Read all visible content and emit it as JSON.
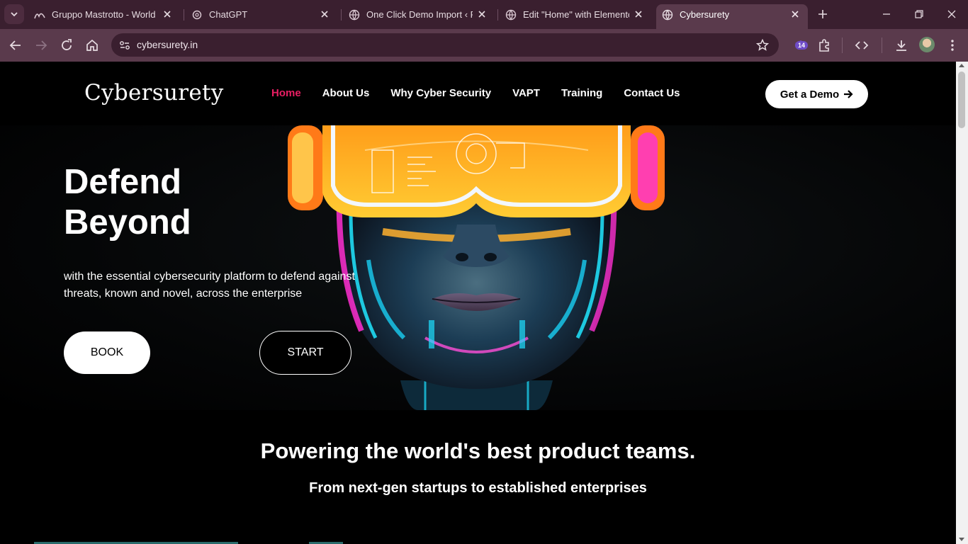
{
  "browser": {
    "tabs": [
      {
        "title": "Gruppo Mastrotto - World le",
        "active": false
      },
      {
        "title": "ChatGPT",
        "active": false
      },
      {
        "title": "One Click Demo Import ‹ Ru",
        "active": false
      },
      {
        "title": "Edit \"Home\" with Elementor",
        "active": false
      },
      {
        "title": "Cybersurety",
        "active": true
      }
    ],
    "url": "cybersurety.in",
    "extension_badge": "14",
    "colors": {
      "frame": "#3a1f2f",
      "toolbar": "#5a3a4c"
    }
  },
  "site": {
    "logo": "Cybersurety",
    "nav": [
      {
        "label": "Home",
        "active": true
      },
      {
        "label": "About Us",
        "active": false
      },
      {
        "label": "Why Cyber Security",
        "active": false
      },
      {
        "label": "VAPT",
        "active": false
      },
      {
        "label": "Training",
        "active": false
      },
      {
        "label": "Contact Us",
        "active": false
      }
    ],
    "cta_label": "Get a Demo",
    "accent_color": "#e91e63"
  },
  "hero": {
    "title_line1": "Defend",
    "title_line2": "Beyond",
    "subtitle": "with the essential cybersecurity platform to defend against threats, known and novel, across the enterprise",
    "book_label": "BOOK",
    "start_label": "START",
    "image_icon": "cyber-face-vr-headset-image"
  },
  "section": {
    "title": "Powering the world's best product teams.",
    "subtitle": "From next-gen startups to established enterprises"
  }
}
